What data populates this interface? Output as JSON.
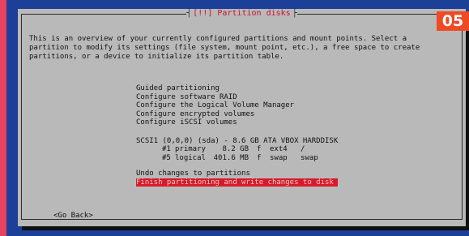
{
  "dialog": {
    "title": "[!!] Partition disks",
    "description": [
      "This is an overview of your currently configured partitions and mount points. Select a",
      "partition to modify its settings (file system, mount point, etc.), a free space to create",
      "partitions, or a device to initialize its partition table."
    ],
    "menu_options": [
      "Guided partitioning",
      "Configure software RAID",
      "Configure the Logical Volume Manager",
      "Configure encrypted volumes",
      "Configure iSCSI volumes"
    ],
    "disk": "SCSI1 (0,0,0) (sda) - 8.6 GB ATA VBOX HARDDISK",
    "partitions": [
      {
        "number": "#1",
        "type": "primary",
        "size": "8.2 GB",
        "flag": "f",
        "fs": "ext4",
        "mount": "/"
      },
      {
        "number": "#5",
        "type": "logical",
        "size": "401.6 MB",
        "flag": "f",
        "fs": "swap",
        "mount": "swap"
      }
    ],
    "undo_label": "Undo changes to partitions",
    "finish_label": "Finish partitioning and write changes to disk",
    "go_back_label": "<Go Back>"
  },
  "step_badge": "05",
  "colors": {
    "screen_background": "#1c3f98",
    "dialog_background": "#b9b9b9",
    "selection_highlight": "#d81a2a",
    "title_text": "#c9152f",
    "badge_background": "#f04a25",
    "page_border": "#e8415f"
  }
}
